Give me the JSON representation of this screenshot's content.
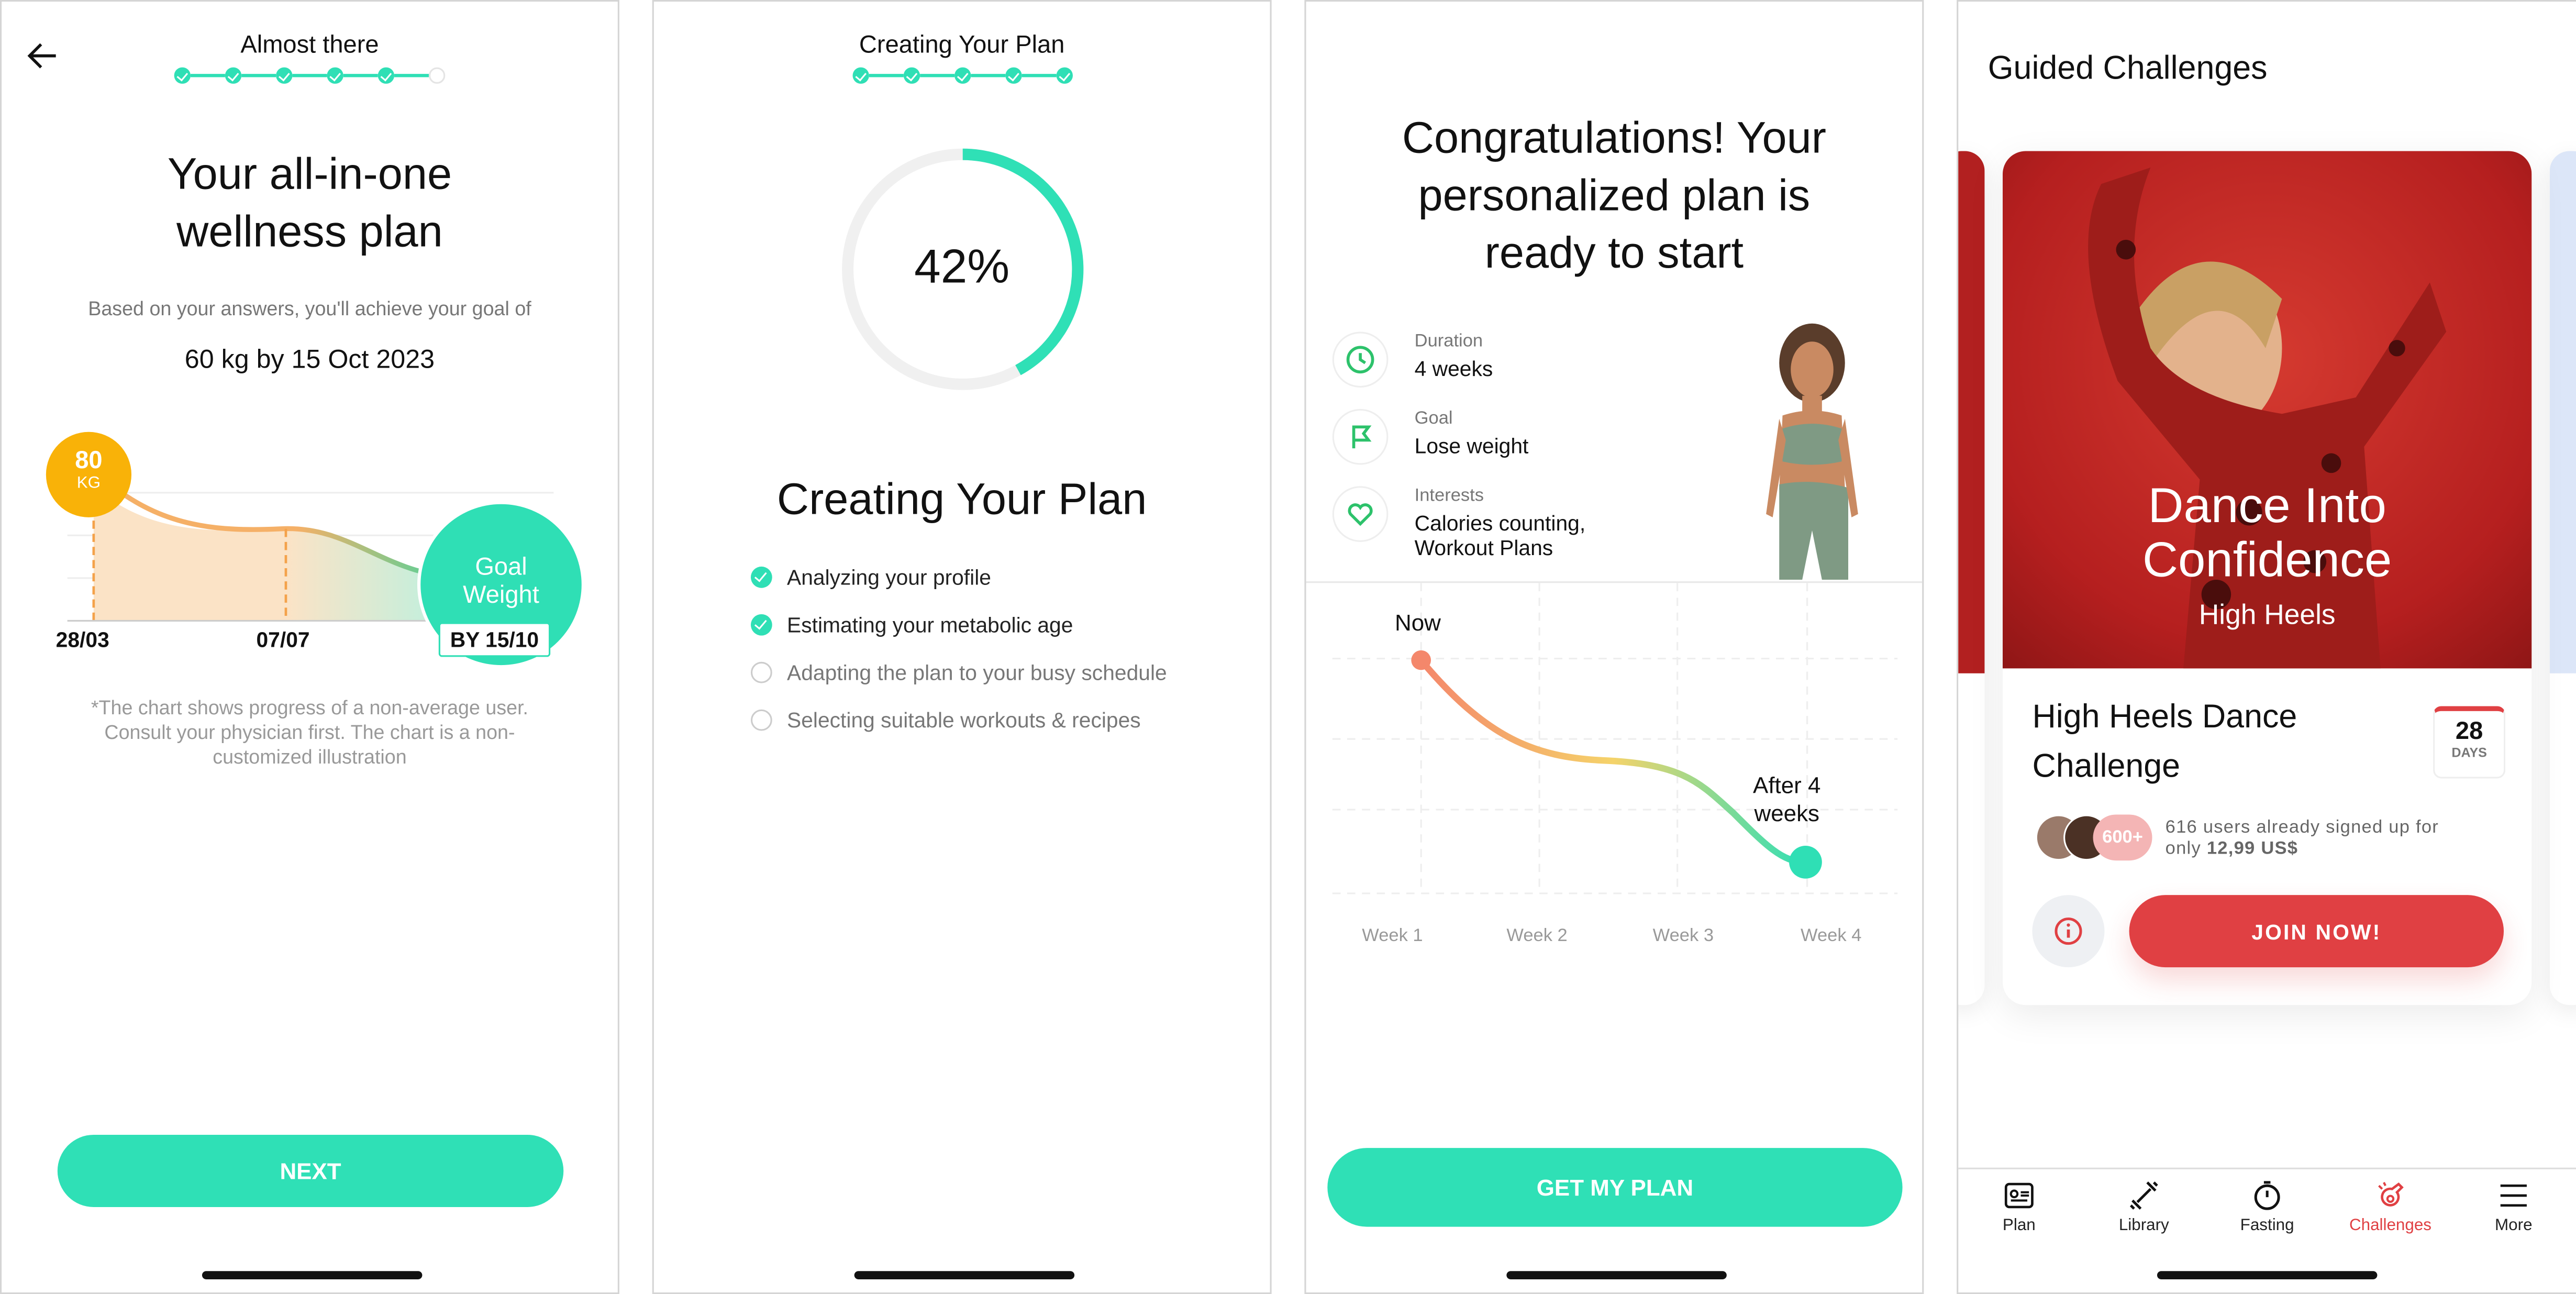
{
  "colors": {
    "accent": "#2fe0b6",
    "orange": "#f9b208",
    "red": "#e04043",
    "coral": "#f4876b"
  },
  "screen1": {
    "back_icon": "arrow-left-icon",
    "step_title": "Almost there",
    "steps_done": 5,
    "steps_total": 6,
    "title_line1": "Your all-in-one",
    "title_line2": "wellness plan",
    "subtitle": "Based on your answers, you'll achieve your goal of",
    "goal": "60 kg by 15 Oct 2023",
    "start_value": "80",
    "start_unit": "KG",
    "goal_label_line1": "Goal",
    "goal_label_line2": "Weight",
    "dates": [
      "28/03",
      "07/07",
      "BY 15/10"
    ],
    "disclaimer_line1": "*The chart shows progress of a non-average user.",
    "disclaimer_line2": "Consult your physician first. The chart is a non-",
    "disclaimer_line3": "customized illustration",
    "next_label": "NEXT"
  },
  "screen2": {
    "step_title": "Creating Your Plan",
    "steps_done": 5,
    "steps_total": 5,
    "progress_percent": 42,
    "progress_label": "42%",
    "title": "Creating Your Plan",
    "checklist": [
      {
        "label": "Analyzing your profile",
        "done": true
      },
      {
        "label": "Estimating your metabolic age",
        "done": true
      },
      {
        "label": "Adapting the plan to your busy schedule",
        "done": false
      },
      {
        "label": "Selecting suitable workouts & recipes",
        "done": false
      }
    ]
  },
  "screen3": {
    "title_line1": "Congratulations! Your",
    "title_line2": "personalized plan is",
    "title_line3": "ready to start",
    "details": [
      {
        "icon": "clock-icon",
        "label": "Duration",
        "value": "4 weeks"
      },
      {
        "icon": "flag-icon",
        "label": "Goal",
        "value": "Lose weight"
      },
      {
        "icon": "heart-icon",
        "label": "Interests",
        "value": "Calories counting,",
        "value2": "Workout Plans"
      }
    ],
    "now_label": "Now",
    "after_label_line1": "After 4",
    "after_label_line2": "weeks",
    "weeks": [
      "Week 1",
      "Week 2",
      "Week 3",
      "Week 4"
    ],
    "cta_label": "GET MY PLAN"
  },
  "screen4": {
    "title": "Guided Challenges",
    "banner_title_line1": "Dance Into",
    "banner_title_line2": "Confidence",
    "banner_subtitle": "High Heels",
    "card_title_line1": "High Heels Dance",
    "card_title_line2": "Challenge",
    "days_value": "28",
    "days_label": "DAYS",
    "users_badge": "600+",
    "users_text": "616 users already signed up for",
    "price_prefix": "only",
    "price": "12,99 US$",
    "join_label": "JOIN NOW!",
    "tabs": [
      {
        "label": "Plan",
        "icon": "plan-icon",
        "active": false
      },
      {
        "label": "Library",
        "icon": "dumbbell-icon",
        "active": false
      },
      {
        "label": "Fasting",
        "icon": "stopwatch-icon",
        "active": false
      },
      {
        "label": "Challenges",
        "icon": "whistle-icon",
        "active": true
      },
      {
        "label": "More",
        "icon": "menu-icon",
        "active": false
      }
    ]
  }
}
